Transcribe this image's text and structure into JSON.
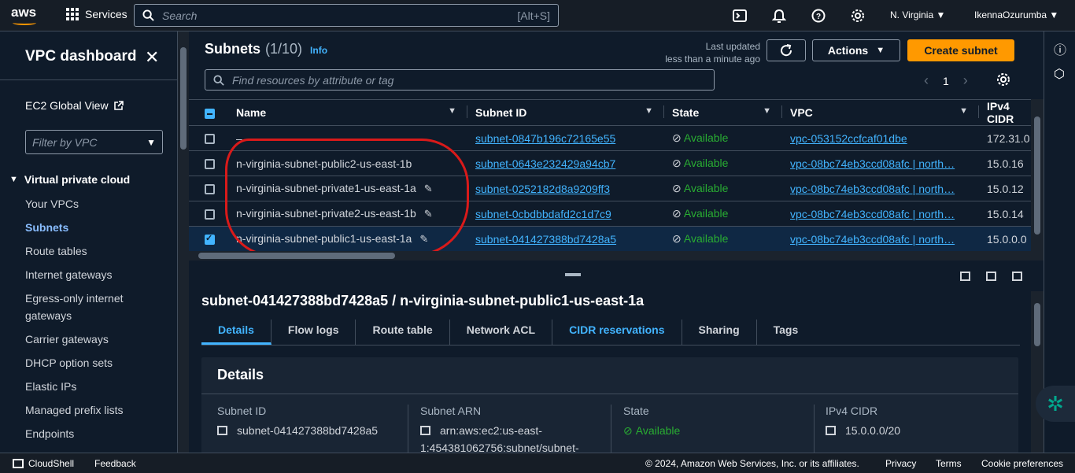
{
  "topbar": {
    "logo": "aws",
    "services": "Services",
    "search_placeholder": "Search",
    "search_hint": "[Alt+S]",
    "region": "N. Virginia ▼",
    "user": "IkennaOzurumba ▼"
  },
  "sidebar": {
    "title": "VPC dashboard",
    "ec2": "EC2 Global View",
    "filter_placeholder": "Filter by VPC",
    "section": "Virtual private cloud",
    "items": [
      "Your VPCs",
      "Subnets",
      "Route tables",
      "Internet gateways",
      "Egress-only internet gateways",
      "Carrier gateways",
      "DHCP option sets",
      "Elastic IPs",
      "Managed prefix lists",
      "Endpoints"
    ]
  },
  "panel": {
    "title": "Subnets",
    "count": "(1/10)",
    "info": "Info",
    "last_updated_1": "Last updated",
    "last_updated_2": "less than a minute ago",
    "actions": "Actions",
    "create": "Create subnet",
    "find_placeholder": "Find resources by attribute or tag",
    "page": "1"
  },
  "table": {
    "columns": [
      "Name",
      "Subnet ID",
      "State",
      "VPC",
      "IPv4 CIDR"
    ],
    "rows": [
      {
        "name": "–",
        "id": "subnet-0847b196c72165e55",
        "state": "Available",
        "vpc": "vpc-053152ccfcaf01dbe",
        "cidr": "172.31.0"
      },
      {
        "name": "n-virginia-subnet-public2-us-east-1b",
        "id": "subnet-0643e232429a94cb7",
        "state": "Available",
        "vpc": "vpc-08bc74eb3ccd08afc | north…",
        "cidr": "15.0.16"
      },
      {
        "name": "n-virginia-subnet-private1-us-east-1a",
        "id": "subnet-0252182d8a9209ff3",
        "state": "Available",
        "vpc": "vpc-08bc74eb3ccd08afc | north…",
        "cidr": "15.0.12"
      },
      {
        "name": "n-virginia-subnet-private2-us-east-1b",
        "id": "subnet-0cbdbbdafd2c1d7c9",
        "state": "Available",
        "vpc": "vpc-08bc74eb3ccd08afc | north…",
        "cidr": "15.0.14"
      },
      {
        "name": "n-virginia-subnet-public1-us-east-1a",
        "id": "subnet-041427388bd7428a5",
        "state": "Available",
        "vpc": "vpc-08bc74eb3ccd08afc | north…",
        "cidr": "15.0.0.0"
      }
    ]
  },
  "detail": {
    "title": "subnet-041427388bd7428a5 / n-virginia-subnet-public1-us-east-1a",
    "tabs": [
      "Details",
      "Flow logs",
      "Route table",
      "Network ACL",
      "CIDR reservations",
      "Sharing",
      "Tags"
    ],
    "card_title": "Details",
    "subnet_id_label": "Subnet ID",
    "subnet_id": "subnet-041427388bd7428a5",
    "arn_label": "Subnet ARN",
    "arn_1": "arn:aws:ec2:us-east-",
    "arn_2": "1:454381062756:subnet/subnet-",
    "state_label": "State",
    "state": "Available",
    "cidr_label": "IPv4 CIDR",
    "cidr": "15.0.0.0/20"
  },
  "footer": {
    "cloudshell": "CloudShell",
    "feedback": "Feedback",
    "copyright": "© 2024, Amazon Web Services, Inc. or its affiliates.",
    "privacy": "Privacy",
    "terms": "Terms",
    "cookies": "Cookie preferences"
  },
  "colors": {
    "accent": "#ff9900",
    "link": "#42b4ff",
    "success": "#29ad32",
    "annotation": "#d91a1a"
  }
}
